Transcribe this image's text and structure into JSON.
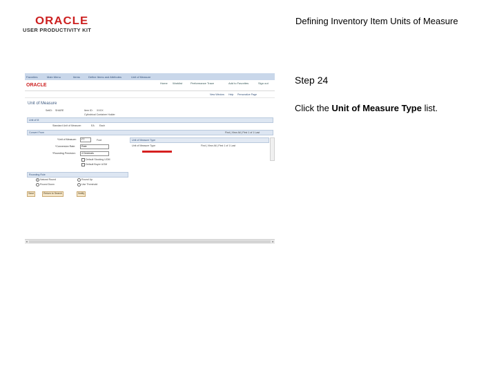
{
  "slide": {
    "logo_brand": "ORACLE",
    "logo_sub": "USER PRODUCTIVITY KIT",
    "title": "Defining Inventory Item Units of Measure",
    "step": "Step 24",
    "instruction_prefix": "Click the ",
    "instruction_bold": "Unit of Measure Type",
    "instruction_suffix": " list."
  },
  "colors": {
    "highlight": "#d62020",
    "oracle_red": "#cc1f1f",
    "nav_blue": "#c9d7ea",
    "link_blue": "#35527a"
  },
  "screenshot": {
    "nav": [
      "Favorites",
      "Main Menu",
      "Items",
      "Define Items and Attributes",
      "Unit of Measure"
    ],
    "brand": "ORACLE",
    "header_links": [
      "Home",
      "Worklist",
      "Performance Trace",
      "Add to Favorites",
      "Sign out"
    ],
    "subheader_links": [
      "New Window",
      "Help",
      "Personalize Page"
    ],
    "page_title": "Unit of Measure",
    "setid_label": "SetID:",
    "setid_value": "SHARE",
    "item_label": "Item ID:",
    "item_value": "XXXX",
    "item_desc": "Cylindrical Container Holder",
    "band_unit": "Unit of M",
    "std_uom_label": "Standard Unit of Measure:",
    "std_uom_value": "EA",
    "std_uom_desc": "Each",
    "band_convert": "Convert From",
    "grid_right_links": "Find | View All | First 1 of 1 Last",
    "uom_label": "*Unit of Measure:",
    "uom_value": "FT",
    "uom_desc": "Foot",
    "factor_label": "*Conversion Rate:",
    "factor_value": "Rate",
    "rounding_label": "*Rounding Precision:",
    "rounding_value": "4 Decimals",
    "check_label_1": "Default Stocking UOM",
    "check_label_2": "Default Buyer UOM",
    "uom_type_header": "Unit of Measure Type",
    "uom_type_col": "Unit of Measure Type",
    "uom_type_links": "Find | View All | First 1 of 1 Last",
    "rounding_band": "Rounding Rule",
    "radio_1": "Natural Round",
    "radio_2": "Round Up",
    "radio_3": "Round Down",
    "radio_4": "Use Threshold",
    "buttons": [
      "Save",
      "Return to Search",
      "Notify"
    ]
  }
}
